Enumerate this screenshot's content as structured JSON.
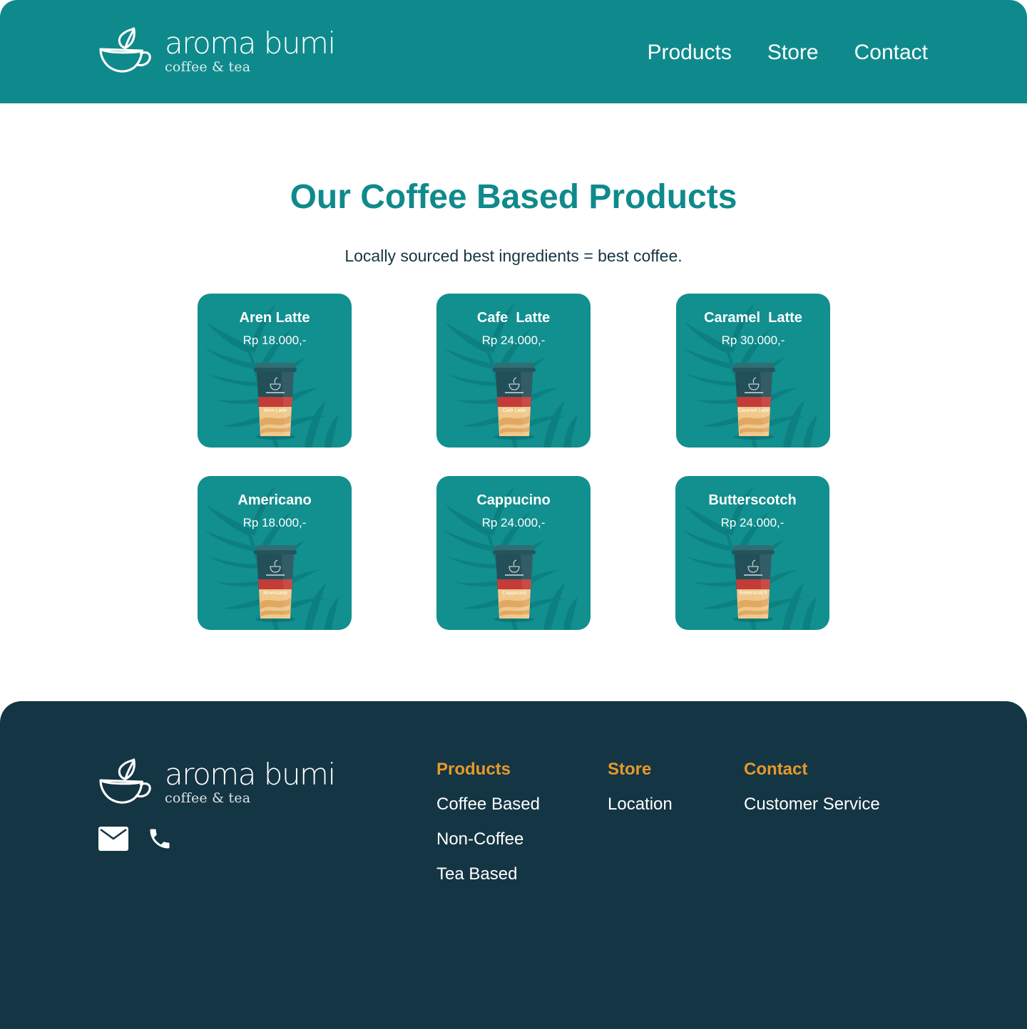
{
  "brand": {
    "name": "aroma bumi",
    "tagline": "coffee & tea"
  },
  "nav": {
    "products": "Products",
    "store": "Store",
    "contact": "Contact"
  },
  "main": {
    "title": "Our Coffee Based Products",
    "subtitle": "Locally sourced best ingredients = best coffee."
  },
  "products": [
    {
      "name": "Aren Latte",
      "price": "Rp 18.000,-",
      "cup_label": "Aren Latte"
    },
    {
      "name": "Cafe  Latte",
      "price": "Rp 24.000,-",
      "cup_label": "Café Latte"
    },
    {
      "name": "Caramel  Latte",
      "price": "Rp 30.000,-",
      "cup_label": "Caramel Latte"
    },
    {
      "name": "Americano",
      "price": "Rp 18.000,-",
      "cup_label": "Americano"
    },
    {
      "name": "Cappucino",
      "price": "Rp 24.000,-",
      "cup_label": "Cappucino"
    },
    {
      "name": "Butterscotch",
      "price": "Rp 24.000,-",
      "cup_label": "Butterscotch"
    }
  ],
  "footer": {
    "icons": [
      "mail-icon",
      "phone-icon"
    ],
    "columns": [
      {
        "title": "Products",
        "links": [
          "Coffee Based",
          "Non-Coffee",
          "Tea Based"
        ]
      },
      {
        "title": "Store",
        "links": [
          "Location"
        ]
      },
      {
        "title": "Contact",
        "links": [
          "Customer Service"
        ]
      }
    ]
  },
  "colors": {
    "header_bg": "#0f8a8c",
    "card_bg": "#128f8f",
    "footer_bg": "#143543",
    "accent_orange": "#e6992a",
    "heading_teal": "#0f8a8c"
  }
}
